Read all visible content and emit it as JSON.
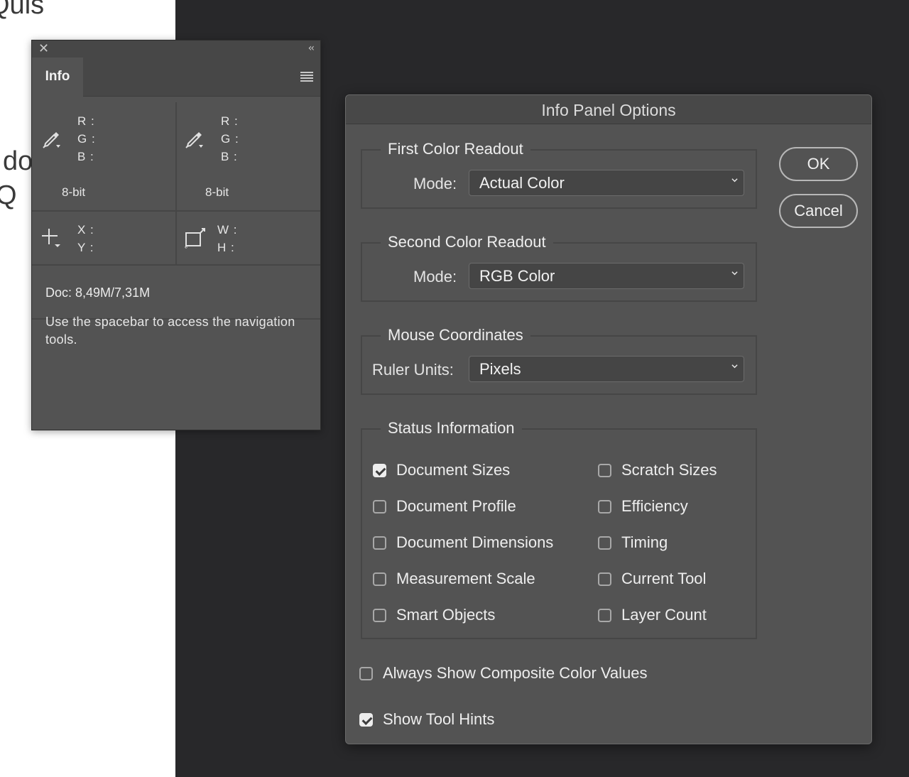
{
  "document_text": {
    "line1": "Quis",
    "line2": "do",
    "line3": "Q"
  },
  "info_panel": {
    "tab": "Info",
    "first_readout": {
      "r": "R :",
      "g": "G :",
      "b": "B :",
      "bits": "8-bit"
    },
    "second_readout": {
      "r": "R :",
      "g": "G :",
      "b": "B :",
      "bits": "8-bit"
    },
    "coords": {
      "x": "X :",
      "y": "Y :"
    },
    "size": {
      "w": "W :",
      "h": "H :"
    },
    "doc_sizes": "Doc: 8,49M/7,31M",
    "tool_hint": "Use the spacebar to access the navigation tools.",
    "icons": [
      "close-icon",
      "collapse-icon",
      "panel-menu-icon",
      "eyedropper-icon",
      "crosshair-icon",
      "selection-size-icon"
    ]
  },
  "dialog": {
    "title": "Info Panel Options",
    "first_color_readout": {
      "title": "First Color Readout",
      "mode_label": "Mode:",
      "mode_value": "Actual Color"
    },
    "second_color_readout": {
      "title": "Second Color Readout",
      "mode_label": "Mode:",
      "mode_value": "RGB Color"
    },
    "mouse_coordinates": {
      "title": "Mouse Coordinates",
      "units_label": "Ruler Units:",
      "units_value": "Pixels"
    },
    "status_information": {
      "title": "Status Information",
      "left": [
        {
          "label": "Document Sizes",
          "checked": true
        },
        {
          "label": "Document Profile",
          "checked": false
        },
        {
          "label": "Document Dimensions",
          "checked": false
        },
        {
          "label": "Measurement Scale",
          "checked": false
        },
        {
          "label": "Smart Objects",
          "checked": false
        }
      ],
      "right": [
        {
          "label": "Scratch Sizes",
          "checked": false
        },
        {
          "label": "Efficiency",
          "checked": false
        },
        {
          "label": "Timing",
          "checked": false
        },
        {
          "label": "Current Tool",
          "checked": false
        },
        {
          "label": "Layer Count",
          "checked": false
        }
      ]
    },
    "always_show_composite": {
      "label": "Always Show Composite Color Values",
      "checked": false
    },
    "show_tool_hints": {
      "label": "Show Tool Hints",
      "checked": true
    },
    "ok_label": "OK",
    "cancel_label": "Cancel"
  },
  "colors": {
    "app_background": "#28282a",
    "panel": "#535353",
    "panel_dark": "#474747",
    "document": "#ffffff"
  }
}
